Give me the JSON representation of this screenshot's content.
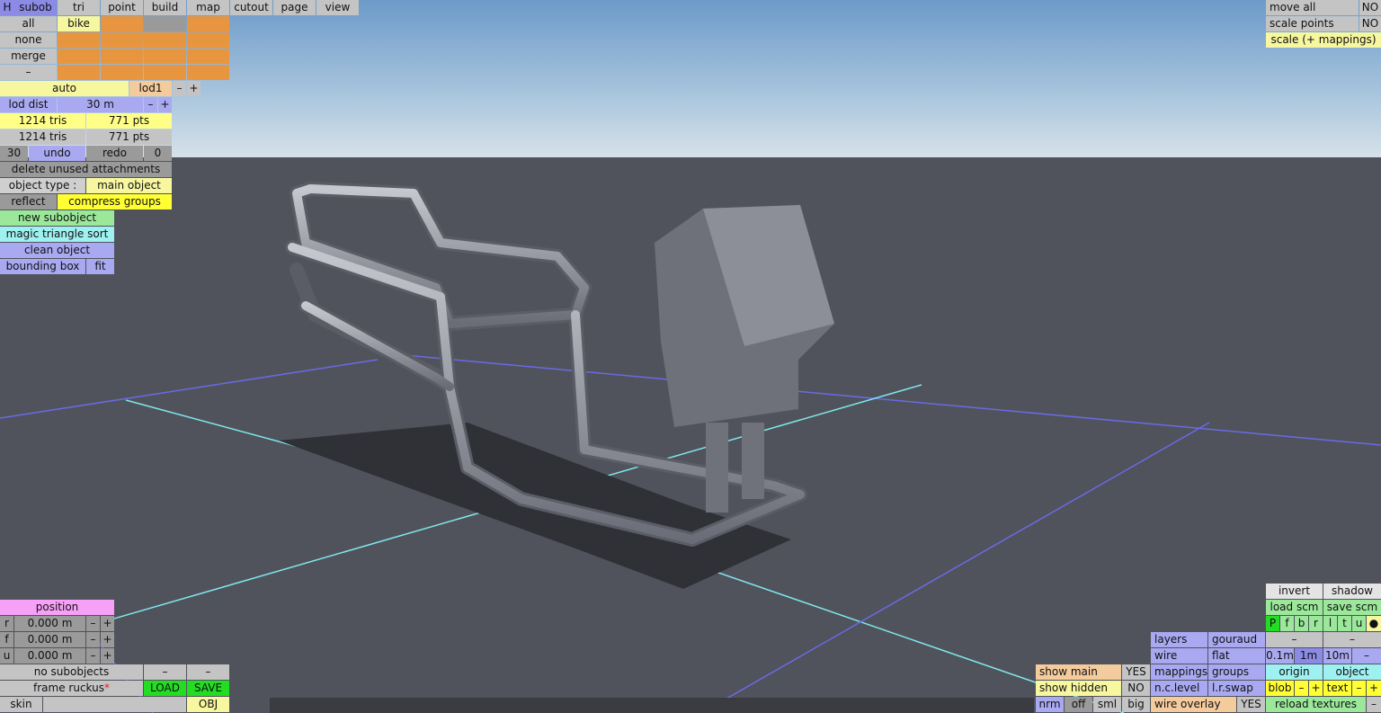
{
  "menu": {
    "h": "H",
    "tabs": [
      "subob",
      "tri",
      "point",
      "build",
      "map",
      "cutout",
      "page",
      "view"
    ]
  },
  "subobject_grid": {
    "row_labels": [
      "all",
      "none",
      "merge",
      "–"
    ],
    "first_cell": "bike"
  },
  "lod": {
    "auto": "auto",
    "name": "lod1",
    "minus": "–",
    "plus": "+",
    "dist_label": "lod dist",
    "dist_value": "30 m"
  },
  "stats": {
    "tris1": "1214 tris",
    "pts1": "771 pts",
    "tris2": "1214 tris",
    "pts2": "771 pts"
  },
  "undo": {
    "count": "30",
    "undo": "undo",
    "redo": "redo",
    "redo_count": "0"
  },
  "tools": {
    "delete": "delete unused attachments",
    "object_type_label": "object type :",
    "object_type_value": "main object",
    "reflect": "reflect",
    "compress": "compress groups",
    "new_sub": "new subobject",
    "magic": "magic triangle sort",
    "clean": "clean object",
    "bbox": "bounding box",
    "fit": "fit"
  },
  "top_right": {
    "move_all": "move all",
    "move_all_val": "NO",
    "scale_points": "scale points",
    "scale_points_val": "NO",
    "scale_map": "scale (+ mappings)"
  },
  "position": {
    "title": "position",
    "r": "r",
    "f": "f",
    "u": "u",
    "r_val": "0.000 m",
    "f_val": "0.000 m",
    "u_val": "0.000 m",
    "minus": "–",
    "plus": "+"
  },
  "bottom_left": {
    "no_sub": "no subobjects",
    "dash": "–",
    "frame": "frame ruckus",
    "star": "*",
    "load": "LOAD",
    "save": "SAVE",
    "skin": "skin",
    "obj": "OBJ"
  },
  "view_opts": {
    "show_main": "show main",
    "show_main_val": "YES",
    "show_hidden": "show hidden",
    "show_hidden_val": "NO",
    "nrm": "nrm",
    "off": "off",
    "sml": "sml",
    "big": "big",
    "layers": "layers",
    "gouraud": "gouraud",
    "wire": "wire",
    "flat": "flat",
    "mappings": "mappings",
    "groups": "groups",
    "nclevel": "n.c.level",
    "lrswap": "l.r.swap",
    "wire_overlay": "wire overlay",
    "wire_overlay_val": "YES"
  },
  "right_panel": {
    "invert": "invert",
    "shadow": "shadow",
    "load_scm": "load scm",
    "save_scm": "save scm",
    "views": [
      "P",
      "f",
      "b",
      "r",
      "l",
      "t",
      "u"
    ],
    "dot": "●",
    "dash": "–",
    "g1": "0.1m",
    "g2": "1m",
    "g3": "10m",
    "origin": "origin",
    "object": "object",
    "blob": "blob",
    "text": "text",
    "minus": "–",
    "plus": "+",
    "reload": "reload textures"
  }
}
